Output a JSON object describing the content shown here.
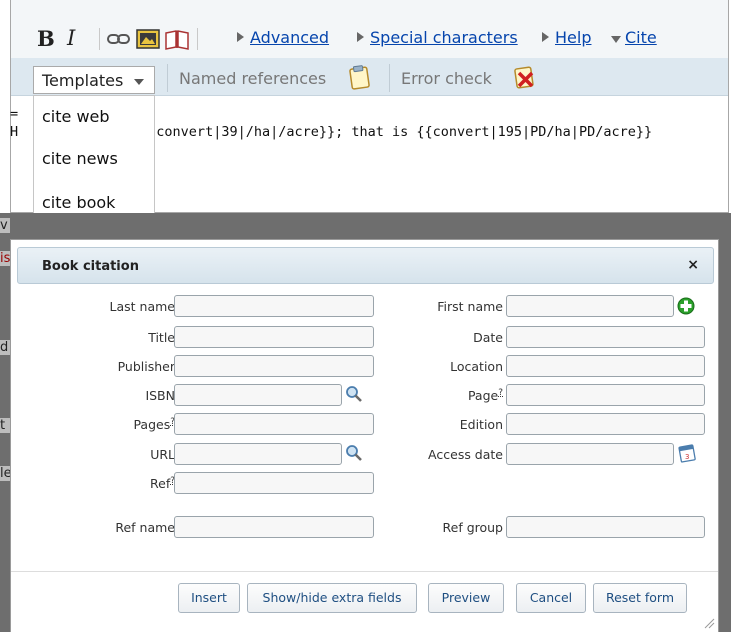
{
  "toolbar": {
    "bold_label": "B",
    "italic_label": "I",
    "advanced_label": "Advanced",
    "special_chars_label": "Special characters",
    "help_label": "Help",
    "cite_label": "Cite",
    "icons": [
      "link-icon",
      "image-icon",
      "book-icon"
    ]
  },
  "cite_toolbar": {
    "templates_label": "Templates",
    "named_refs_label": "Named references",
    "error_check_label": "Error check"
  },
  "templates_menu": {
    "items": [
      "cite web",
      "cite news",
      "cite book"
    ]
  },
  "editor": {
    "line1": "=",
    "line2": "H          y of {{convert|39|/ha|/acre}}; that is {{convert|195|PD/ha|PD/acre}}"
  },
  "background_fragments": [
    "v",
    "is",
    "d",
    "t",
    "le"
  ],
  "dialog": {
    "title": "Book citation",
    "close_label": "×",
    "fields_left": [
      {
        "label": "Last name",
        "help": ""
      },
      {
        "label": "Title",
        "help": ""
      },
      {
        "label": "Publisher",
        "help": ""
      },
      {
        "label": "ISBN",
        "help": ""
      },
      {
        "label": "Pages",
        "help": "?"
      },
      {
        "label": "URL",
        "help": ""
      },
      {
        "label": "Ref",
        "help": "?"
      }
    ],
    "fields_right": [
      {
        "label": "First name",
        "help": ""
      },
      {
        "label": "Date",
        "help": ""
      },
      {
        "label": "Location",
        "help": ""
      },
      {
        "label": "Page",
        "help": "?"
      },
      {
        "label": "Edition",
        "help": ""
      },
      {
        "label": "Access date",
        "help": ""
      }
    ],
    "ref_name_label": "Ref name",
    "ref_group_label": "Ref group",
    "buttons": {
      "insert": "Insert",
      "show_hide": "Show/hide extra fields",
      "preview": "Preview",
      "cancel": "Cancel",
      "reset": "Reset form"
    }
  },
  "colors": {
    "link": "#0645ad",
    "toolbar_bg": "#dde8f0",
    "button_text": "#1f4f82",
    "add_green": "#2aa02a"
  }
}
